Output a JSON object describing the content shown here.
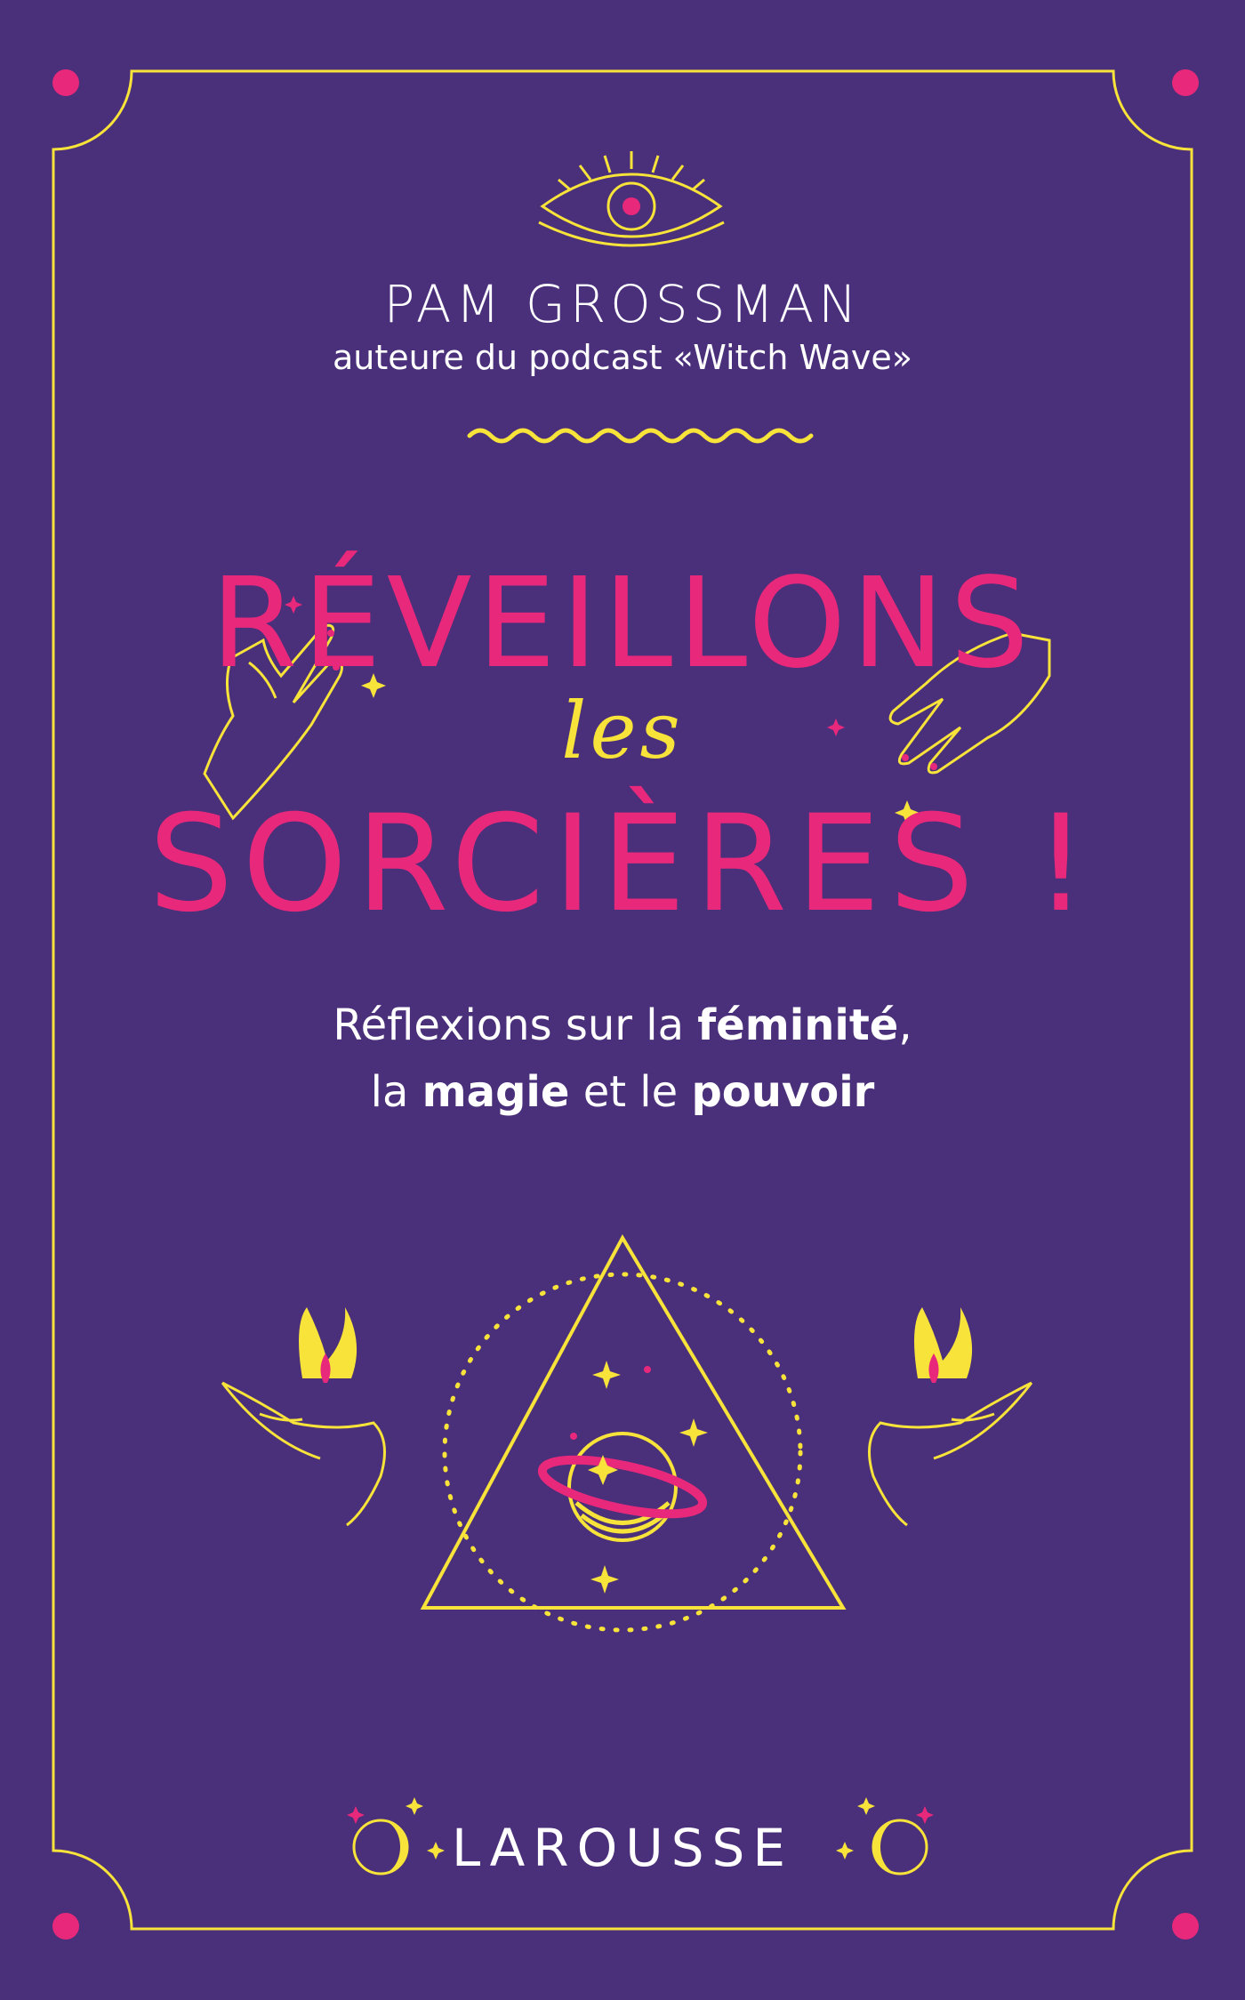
{
  "cover": {
    "author": "PAM GROSSMAN",
    "author_note": "auteure du podcast «Witch Wave»",
    "title_line_1": "RÉVEILLONS",
    "title_line_2": "les",
    "title_line_3": "SORCIÈRES !",
    "tagline": {
      "line1_a": "Réflexions sur la ",
      "line1_b": "féminité",
      "line1_c": ",",
      "line2_a": "la ",
      "line2_b": "magie",
      "line2_c": " et le ",
      "line2_d": "pouvoir"
    },
    "publisher": "LAROUSSE"
  },
  "colors": {
    "background": "#4a2f7a",
    "accent_yellow": "#f7e33a",
    "accent_pink": "#e8287b",
    "text_white": "#ffffff"
  },
  "icons": [
    "eye-icon",
    "wave-divider-icon",
    "hand-icon",
    "sparkle-icon",
    "candle-hand-icon",
    "triangle-planet-icon",
    "moon-icon",
    "corner-dot-icon"
  ]
}
